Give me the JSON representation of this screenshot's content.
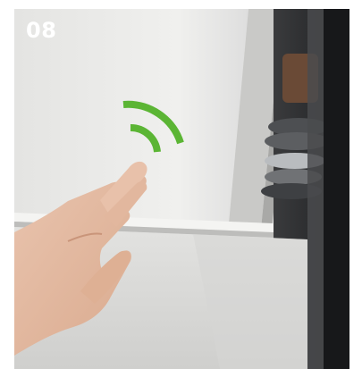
{
  "step": {
    "number": "08"
  },
  "photo": {
    "subject": "hand-touching-cabinet-door",
    "signal_icon": "touch-signal-icon",
    "colors": {
      "signal": "#5bb534",
      "door": "#e9e9e7",
      "cabinet_interior": "#2a2b2d"
    }
  }
}
